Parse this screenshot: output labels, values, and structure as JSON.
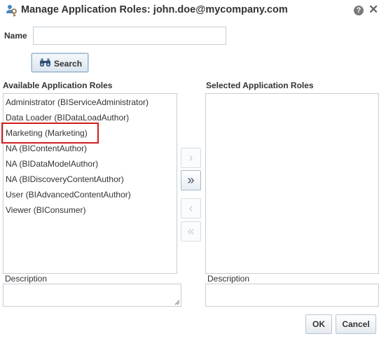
{
  "dialog": {
    "title": "Manage Application Roles: john.doe@mycompany.com",
    "help_glyph": "?",
    "close_glyph": "✕"
  },
  "search": {
    "name_label": "Name",
    "name_value": "",
    "button_label": "Search"
  },
  "available": {
    "label": "Available Application Roles",
    "items": [
      "Administrator (BIServiceAdministrator)",
      "Data Loader (BIDataLoadAuthor)",
      "Marketing (Marketing)",
      "NA (BIContentAuthor)",
      "NA (BIDataModelAuthor)",
      "NA (BIDiscoveryContentAuthor)",
      "User (BIAdvancedContentAuthor)",
      "Viewer (BIConsumer)"
    ],
    "highlighted_item": "Marketing (Marketing)",
    "description_label": "Description",
    "description_value": ""
  },
  "selected": {
    "label": "Selected Application Roles",
    "items": [],
    "description_label": "Description",
    "description_value": ""
  },
  "shuttle": {
    "move": "›",
    "move_all": "»",
    "remove": "‹",
    "remove_all": "«"
  },
  "footer": {
    "ok_label": "OK",
    "cancel_label": "Cancel"
  },
  "colors": {
    "highlight_border": "#d21e1e",
    "input_border": "#c4ced7",
    "button_border": "#9bb3c9"
  },
  "icons": {
    "title": "users-key-icon",
    "search": "binoculars-icon",
    "help": "help-icon",
    "close": "close-icon"
  }
}
